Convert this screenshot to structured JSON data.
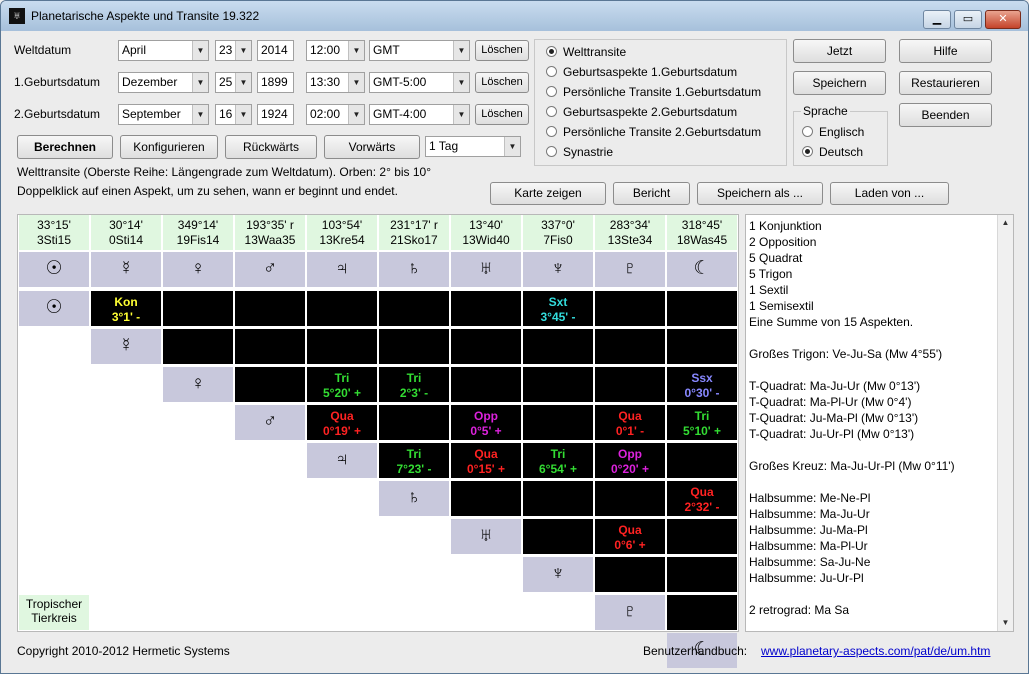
{
  "window": {
    "title": "Planetarische Aspekte und Transite 19.322"
  },
  "dates": [
    {
      "label": "Weltdatum",
      "month": "April",
      "day": "23",
      "year": "2014",
      "time": "12:00",
      "tz": "GMT",
      "clear": "Löschen"
    },
    {
      "label": "1.Geburtsdatum",
      "month": "Dezember",
      "day": "25",
      "year": "1899",
      "time": "13:30",
      "tz": "GMT-5:00",
      "clear": "Löschen"
    },
    {
      "label": "2.Geburtsdatum",
      "month": "September",
      "day": "16",
      "year": "1924",
      "time": "02:00",
      "tz": "GMT-4:00",
      "clear": "Löschen"
    }
  ],
  "toolbar": {
    "calc": "Berechnen",
    "config": "Konfigurieren",
    "back": "Rückwärts",
    "fwd": "Vorwärts",
    "step": "1 Tag"
  },
  "modes": [
    {
      "label": "Welttransite",
      "selected": true
    },
    {
      "label": "Geburtsaspekte 1.Geburtsdatum",
      "selected": false
    },
    {
      "label": "Persönliche Transite 1.Geburtsdatum",
      "selected": false
    },
    {
      "label": "Geburtsaspekte 2.Geburtsdatum",
      "selected": false
    },
    {
      "label": "Persönliche Transite 2.Geburtsdatum",
      "selected": false
    },
    {
      "label": "Synastrie",
      "selected": false
    }
  ],
  "right_buttons": {
    "now": "Jetzt",
    "help": "Hilfe",
    "save": "Speichern",
    "restore": "Restaurieren",
    "quit": "Beenden"
  },
  "language": {
    "title": "Sprache",
    "options": [
      {
        "label": "Englisch",
        "selected": false
      },
      {
        "label": "Deutsch",
        "selected": true
      }
    ]
  },
  "info": {
    "line1": "Welttransite (Oberste Reihe: Längengrade zum Weltdatum).  Orben: 2° bis 10°",
    "line2": "Doppelklick auf einen Aspekt, um zu sehen, wann er beginnt und endet."
  },
  "actions": {
    "chart": "Karte zeigen",
    "report": "Bericht",
    "save_as": "Speichern als ...",
    "load": "Laden von ..."
  },
  "planets": [
    {
      "deg": "33°15'",
      "pos": "3Sti15",
      "sym": "☉"
    },
    {
      "deg": "30°14'",
      "pos": "0Sti14",
      "sym": "☿"
    },
    {
      "deg": "349°14'",
      "pos": "19Fis14",
      "sym": "♀"
    },
    {
      "deg": "193°35' r",
      "pos": "13Waa35",
      "sym": "♂"
    },
    {
      "deg": "103°54'",
      "pos": "13Kre54",
      "sym": "♃"
    },
    {
      "deg": "231°17' r",
      "pos": "21Sko17",
      "sym": "♄"
    },
    {
      "deg": "13°40'",
      "pos": "13Wid40",
      "sym": "♅"
    },
    {
      "deg": "337°0'",
      "pos": "7Fis0",
      "sym": "♆"
    },
    {
      "deg": "283°34'",
      "pos": "13Ste34",
      "sym": "♇"
    },
    {
      "deg": "318°45'",
      "pos": "18Was45",
      "sym": "☾"
    }
  ],
  "aspects": [
    {
      "row": 0,
      "col": 1,
      "name": "Kon",
      "orb": "3°1' -",
      "color": "#ffff33"
    },
    {
      "row": 0,
      "col": 7,
      "name": "Sxt",
      "orb": "3°45' -",
      "color": "#33dddd"
    },
    {
      "row": 2,
      "col": 4,
      "name": "Tri",
      "orb": "5°20' +",
      "color": "#33dd33"
    },
    {
      "row": 2,
      "col": 5,
      "name": "Tri",
      "orb": "2°3' -",
      "color": "#33dd33"
    },
    {
      "row": 2,
      "col": 9,
      "name": "Ssx",
      "orb": "0°30' -",
      "color": "#8888ff"
    },
    {
      "row": 3,
      "col": 4,
      "name": "Qua",
      "orb": "0°19' +",
      "color": "#ff2222"
    },
    {
      "row": 3,
      "col": 6,
      "name": "Opp",
      "orb": "0°5' +",
      "color": "#dd22dd"
    },
    {
      "row": 3,
      "col": 8,
      "name": "Qua",
      "orb": "0°1' -",
      "color": "#ff2222"
    },
    {
      "row": 3,
      "col": 9,
      "name": "Tri",
      "orb": "5°10' +",
      "color": "#33dd33"
    },
    {
      "row": 4,
      "col": 5,
      "name": "Tri",
      "orb": "7°23' -",
      "color": "#33dd33"
    },
    {
      "row": 4,
      "col": 6,
      "name": "Qua",
      "orb": "0°15' +",
      "color": "#ff2222"
    },
    {
      "row": 4,
      "col": 7,
      "name": "Tri",
      "orb": "6°54' +",
      "color": "#33dd33"
    },
    {
      "row": 4,
      "col": 8,
      "name": "Opp",
      "orb": "0°20' +",
      "color": "#dd22dd"
    },
    {
      "row": 5,
      "col": 9,
      "name": "Qua",
      "orb": "2°32' -",
      "color": "#ff2222"
    },
    {
      "row": 6,
      "col": 8,
      "name": "Qua",
      "orb": "0°6' +",
      "color": "#ff2222"
    }
  ],
  "zodiac": {
    "line1": "Tropischer",
    "line2": "Tierkreis"
  },
  "summary": [
    "1 Konjunktion",
    "2 Opposition",
    "5 Quadrat",
    "5 Trigon",
    "1 Sextil",
    "1 Semisextil",
    "Eine Summe von 15 Aspekten.",
    "",
    "Großes Trigon: Ve-Ju-Sa (Mw 4°55')",
    "",
    "T-Quadrat: Ma-Ju-Ur (Mw 0°13')",
    "T-Quadrat: Ma-Pl-Ur (Mw 0°4')",
    "T-Quadrat: Ju-Ma-Pl (Mw 0°13')",
    "T-Quadrat: Ju-Ur-Pl (Mw 0°13')",
    "",
    "Großes Kreuz: Ma-Ju-Ur-Pl (Mw 0°11')",
    "",
    "Halbsumme: Me-Ne-Pl",
    "Halbsumme: Ma-Ju-Ur",
    "Halbsumme: Ju-Ma-Pl",
    "Halbsumme: Ma-Pl-Ur",
    "Halbsumme: Sa-Ju-Ne",
    "Halbsumme: Ju-Ur-Pl",
    "",
    "2 retrograd: Ma Sa"
  ],
  "footer": {
    "copyright": "Copyright 2010-2012 Hermetic Systems",
    "manual_label": "Benutzerhandbuch:",
    "manual_link": "www.planetary-aspects.com/pat/de/um.htm"
  }
}
